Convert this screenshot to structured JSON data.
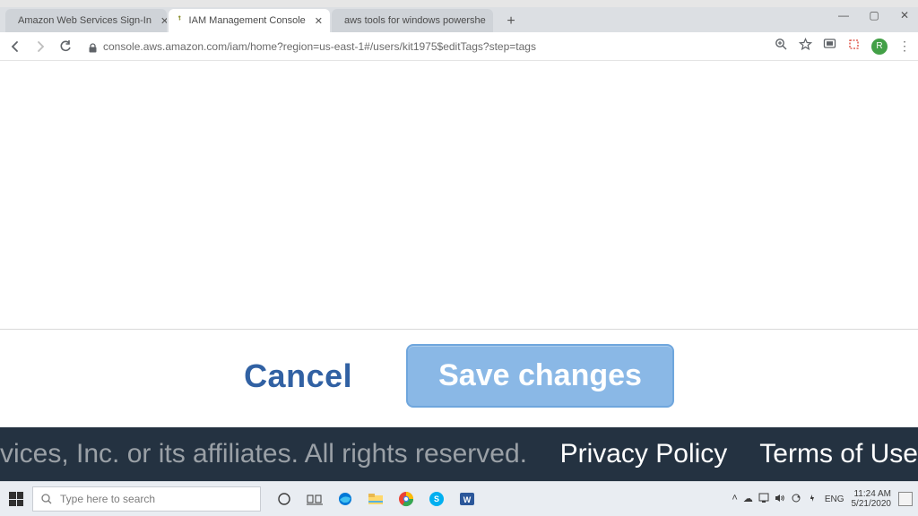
{
  "browser": {
    "tabs": [
      {
        "title": "Amazon Web Services Sign-In"
      },
      {
        "title": "IAM Management Console"
      },
      {
        "title": "aws tools for windows powershe"
      }
    ],
    "url": "console.aws.amazon.com/iam/home?region=us-east-1#/users/kit1975$editTags?step=tags",
    "newtab": "+",
    "win": {
      "min": "—",
      "max": "▢",
      "close": "✕"
    },
    "avatar_letter": "R",
    "menu_dots": "⋮"
  },
  "page": {
    "cancel": "Cancel",
    "save": "Save changes",
    "footer_copy": "vices, Inc. or its affiliates. All rights reserved.",
    "footer_privacy": "Privacy Policy",
    "footer_terms": "Terms of Use"
  },
  "taskbar": {
    "search_placeholder": "Type here to search",
    "lang": "ENG",
    "time": "11:24 AM",
    "date": "5/21/2020"
  }
}
